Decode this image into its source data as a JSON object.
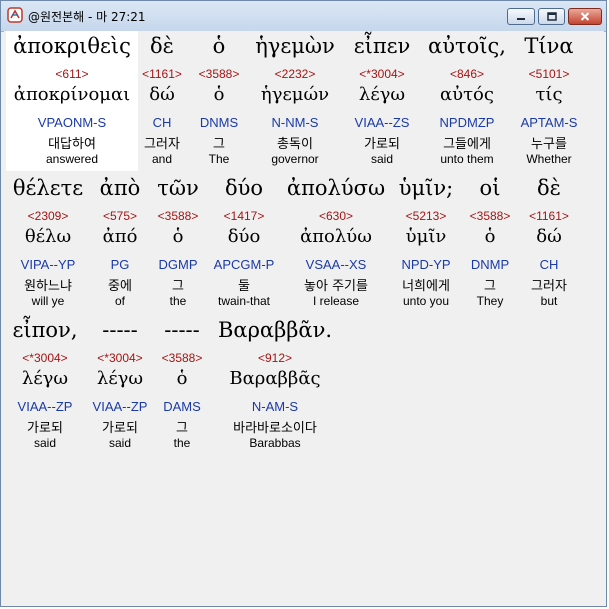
{
  "window": {
    "title": "@원전본해 - 마 27:21"
  },
  "rows": [
    {
      "words": [
        {
          "greek": "ἀποκριθεὶς",
          "strong": "<611>",
          "lemma": "ἀποκρίνομαι",
          "parsing": "VPAONM-S",
          "korean": "대답하여",
          "english": "answered"
        },
        {
          "greek": "δὲ",
          "strong": "<1161>",
          "lemma": "δώ",
          "parsing": "CH",
          "korean": "그러자",
          "english": "and"
        },
        {
          "greek": "ὁ",
          "strong": "<3588>",
          "lemma": "ὁ",
          "parsing": "DNMS",
          "korean": "그",
          "english": "The"
        },
        {
          "greek": "ἡγεμὼν",
          "strong": "<2232>",
          "lemma": "ἡγεμών",
          "parsing": "N-NM-S",
          "korean": "총독이",
          "english": "governor"
        },
        {
          "greek": "εἶπεν",
          "strong": "<*3004>",
          "lemma": "λέγω",
          "parsing": "VIAA--ZS",
          "korean": "가로되",
          "english": "said"
        },
        {
          "greek": "αὐτοῖς,",
          "strong": "<846>",
          "lemma": "αὐτός",
          "parsing": "NPDMZP",
          "korean": "그들에게",
          "english": "unto them"
        },
        {
          "greek": "Τίνα",
          "strong": "<5101>",
          "lemma": "τίς",
          "parsing": "APTAM-S",
          "korean": "누구를",
          "english": "Whether"
        }
      ]
    },
    {
      "words": [
        {
          "greek": "θέλετε",
          "strong": "<2309>",
          "lemma": "θέλω",
          "parsing": "VIPA--YP",
          "korean": "원하느냐",
          "english": "will ye"
        },
        {
          "greek": "ἀπὸ",
          "strong": "<575>",
          "lemma": "ἀπό",
          "parsing": "PG",
          "korean": "중에",
          "english": "of"
        },
        {
          "greek": "τῶν",
          "strong": "<3588>",
          "lemma": "ὁ",
          "parsing": "DGMP",
          "korean": "그",
          "english": "the"
        },
        {
          "greek": "δύο",
          "strong": "<1417>",
          "lemma": "δύο",
          "parsing": "APCGM-P",
          "korean": "둘",
          "english": "twain-that"
        },
        {
          "greek": "ἀπολύσω",
          "strong": "<630>",
          "lemma": "ἀπολύω",
          "parsing": "VSAA--XS",
          "korean": "놓아 주기를",
          "english": "I release"
        },
        {
          "greek": "ὑμῖν;",
          "strong": "<5213>",
          "lemma": "ὑμῖν",
          "parsing": "NPD-YP",
          "korean": "너희에게",
          "english": "unto you"
        },
        {
          "greek": "οἱ",
          "strong": "<3588>",
          "lemma": "ὁ",
          "parsing": "DNMP",
          "korean": "그",
          "english": "They"
        },
        {
          "greek": "δὲ",
          "strong": "<1161>",
          "lemma": "δώ",
          "parsing": "CH",
          "korean": "그러자",
          "english": "but"
        }
      ]
    },
    {
      "words": [
        {
          "greek": "εἶπον,",
          "strong": "<*3004>",
          "lemma": "λέγω",
          "parsing": "VIAA--ZP",
          "korean": "가로되",
          "english": "said"
        },
        {
          "greek": "-----",
          "strong": "<*3004>",
          "lemma": "λέγω",
          "parsing": "VIAA--ZP",
          "korean": "가로되",
          "english": "said"
        },
        {
          "greek": "-----",
          "strong": "<3588>",
          "lemma": "ὁ",
          "parsing": "DAMS",
          "korean": "그",
          "english": "the"
        },
        {
          "greek": "Βαραββᾶν.",
          "strong": "<912>",
          "lemma": "Βαραββᾶς",
          "parsing": "N-AM-S",
          "korean": "바라바로소이다",
          "english": "Barabbas"
        }
      ]
    }
  ]
}
